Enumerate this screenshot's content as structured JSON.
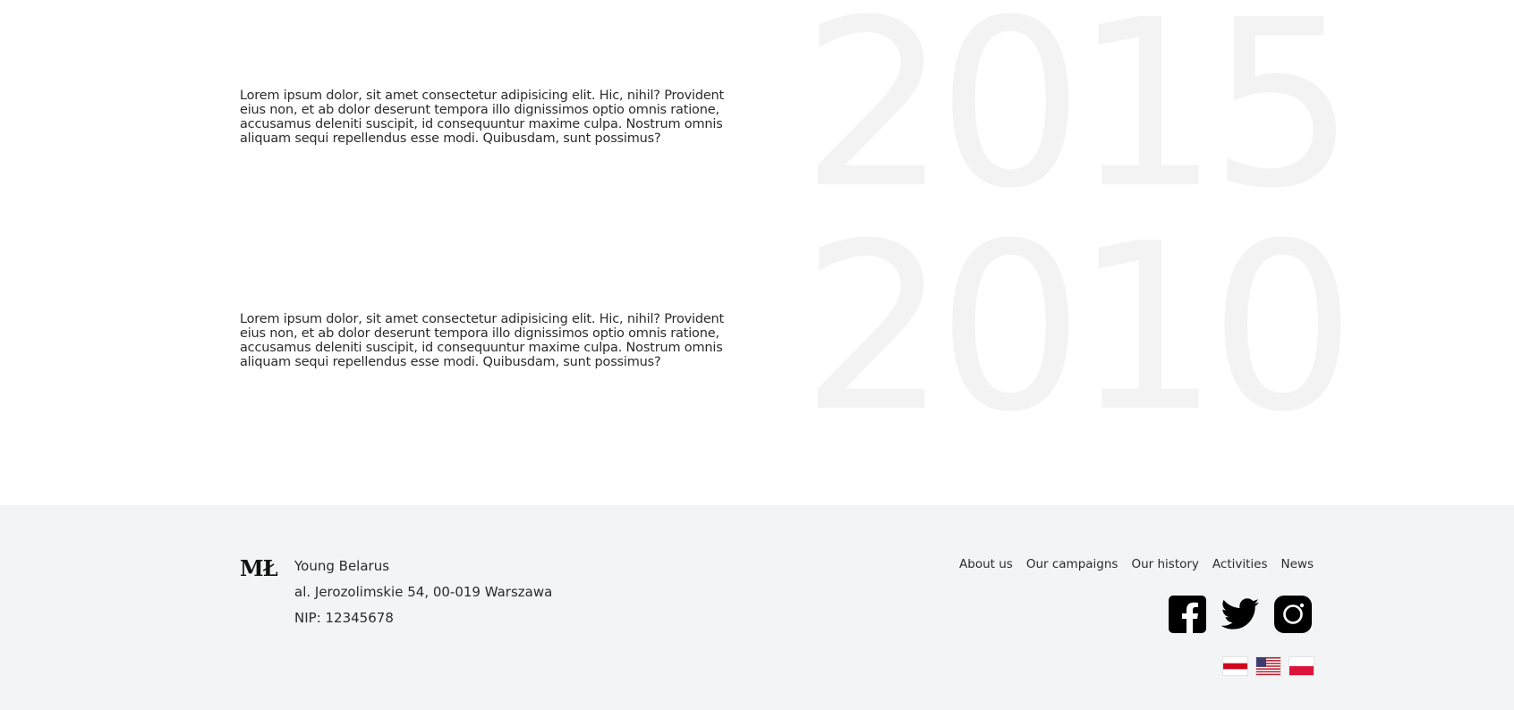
{
  "history": {
    "entries": [
      {
        "year": "2015",
        "text": "Lorem ipsum dolor, sit amet consectetur adipisicing elit. Hic, nihil? Provident eius non, et ab dolor deserunt tempora illo dignissimos optio omnis ratione, accusamus deleniti suscipit, id consequuntur maxime culpa. Nostrum omnis aliquam sequi repellendus esse modi. Quibusdam, sunt possimus?"
      },
      {
        "year": "2010",
        "text": "Lorem ipsum dolor, sit amet consectetur adipisicing elit. Hic, nihil? Provident eius non, et ab dolor deserunt tempora illo dignissimos optio omnis ratione, accusamus deleniti suscipit, id consequuntur maxime culpa. Nostrum omnis aliquam sequi repellendus esse modi. Quibusdam, sunt possimus?"
      }
    ]
  },
  "footer": {
    "logo": "MŁ",
    "org_name": "Young Belarus",
    "address": "al. Jerozolimskie 54, 00-019 Warszawa",
    "nip": "NIP: 12345678",
    "nav": [
      "About us",
      "Our campaigns",
      "Our history",
      "Activities",
      "News"
    ],
    "social_icons": [
      "facebook-icon",
      "twitter-icon",
      "instagram-icon"
    ],
    "language_flags": [
      "belarus-flag",
      "usa-flag",
      "poland-flag"
    ]
  },
  "colors": {
    "footer_bg": "#f3f4f5",
    "year_watermark": "#f3f3f4",
    "text": "#2b2b2b",
    "icon": "#000000"
  }
}
